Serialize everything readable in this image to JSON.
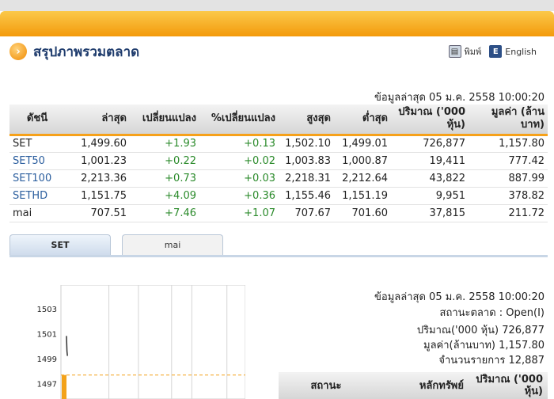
{
  "header": {
    "title": "สรุปภาพรวมตลาด",
    "print_label": "พิมพ์",
    "english_label": "English",
    "print_icon": "printer-icon",
    "english_icon": "english-flag-icon"
  },
  "updated": "ข้อมูลล่าสุด 05 ม.ค. 2558 10:00:20",
  "index_table": {
    "headers": [
      "ดัชนี",
      "ล่าสุด",
      "เปลี่ยนแปลง",
      "%เปลี่ยนแปลง",
      "สูงสุด",
      "ต่ำสุด",
      "ปริมาณ ('000 หุ้น)",
      "มูลค่า (ล้านบาท)"
    ],
    "rows": [
      [
        "SET",
        "1,499.60",
        "+1.93",
        "+0.13",
        "1,502.10",
        "1,499.01",
        "726,877",
        "1,157.80"
      ],
      [
        "SET50",
        "1,001.23",
        "+0.22",
        "+0.02",
        "1,003.83",
        "1,000.87",
        "19,411",
        "777.42"
      ],
      [
        "SET100",
        "2,213.36",
        "+0.73",
        "+0.03",
        "2,218.31",
        "2,212.64",
        "43,822",
        "887.99"
      ],
      [
        "SETHD",
        "1,151.75",
        "+4.09",
        "+0.36",
        "1,155.46",
        "1,151.19",
        "9,951",
        "378.82"
      ],
      [
        "mai",
        "707.51",
        "+7.46",
        "+1.07",
        "707.67",
        "701.60",
        "37,815",
        "211.72"
      ]
    ]
  },
  "tabs": [
    {
      "label": "SET",
      "active": true
    },
    {
      "label": "mai",
      "active": false
    }
  ],
  "chart_data": {
    "type": "line",
    "y_ticks": [
      "1503",
      "1501",
      "1499",
      "1497"
    ],
    "ylim": [
      1496,
      1504
    ],
    "series": [
      {
        "values": [
          1500.8,
          1499.6,
          1499.2
        ]
      }
    ],
    "reference_line": 1497.67
  },
  "market_info": {
    "updated": "ข้อมูลล่าสุด 05 ม.ค. 2558 10:00:20",
    "status": "สถานะตลาด : Open(I)",
    "volume": "ปริมาณ('000 หุ้น) 726,877",
    "value": "มูลค่า(ล้านบาท) 1,157.80",
    "deals": "จำนวนรายการ 12,887"
  },
  "summary_table": {
    "headers": [
      "สถานะ",
      "หลักทรัพย์",
      "ปริมาณ ('000 หุ้น)"
    ]
  }
}
